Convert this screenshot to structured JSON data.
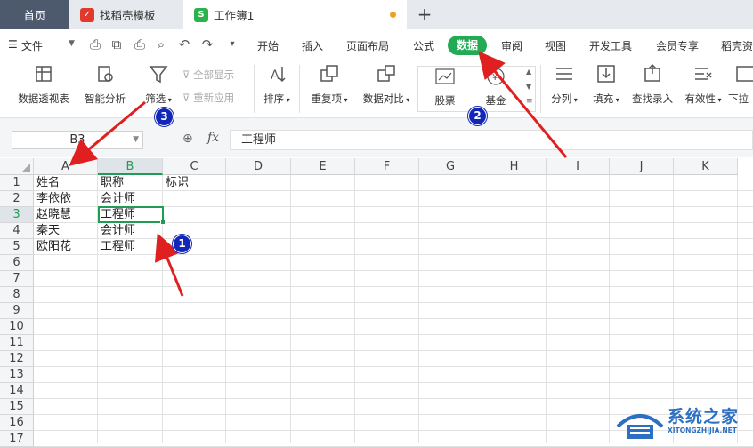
{
  "tabs": {
    "home": "首页",
    "template": "找稻壳模板",
    "doc": "工作簿1",
    "add": "+"
  },
  "menu": {
    "file": "文件",
    "items": [
      "开始",
      "插入",
      "页面布局",
      "公式",
      "数据",
      "审阅",
      "视图",
      "开发工具",
      "会员专享",
      "稻壳资"
    ]
  },
  "ribbon": {
    "pivot": "数据透视表",
    "smart": "智能分析",
    "filter": "筛选",
    "show_all": "全部显示",
    "reapply": "重新应用",
    "sort": "排序",
    "dup": "重复项",
    "compare": "数据对比",
    "stock": "股票",
    "fund": "基金",
    "split": "分列",
    "fill": "填充",
    "lookup": "查找录入",
    "valid": "有效性",
    "dropdown": "下拉"
  },
  "formula_bar": {
    "name_box": "B3",
    "fx": "fx",
    "value": "工程师"
  },
  "sheet": {
    "columns": [
      "A",
      "B",
      "C",
      "D",
      "E",
      "F",
      "G",
      "H",
      "I",
      "J",
      "K"
    ],
    "rows": [
      "1",
      "2",
      "3",
      "4",
      "5",
      "6",
      "7",
      "8",
      "9",
      "10",
      "11",
      "12",
      "13",
      "14",
      "15",
      "16",
      "17"
    ],
    "cells": [
      [
        "姓名",
        "职称",
        "标识"
      ],
      [
        "李依依",
        "会计师",
        ""
      ],
      [
        "赵晓慧",
        "工程师",
        ""
      ],
      [
        "秦天",
        "会计师",
        ""
      ],
      [
        "欧阳花",
        "工程师",
        ""
      ]
    ]
  },
  "badges": [
    "1",
    "2",
    "3"
  ],
  "watermark": {
    "title": "系统之家",
    "url": "XITONGZHIJIA.NET"
  },
  "colors": {
    "accent": "#22aa55",
    "badge": "#1226b8",
    "arrow": "#e02020"
  }
}
